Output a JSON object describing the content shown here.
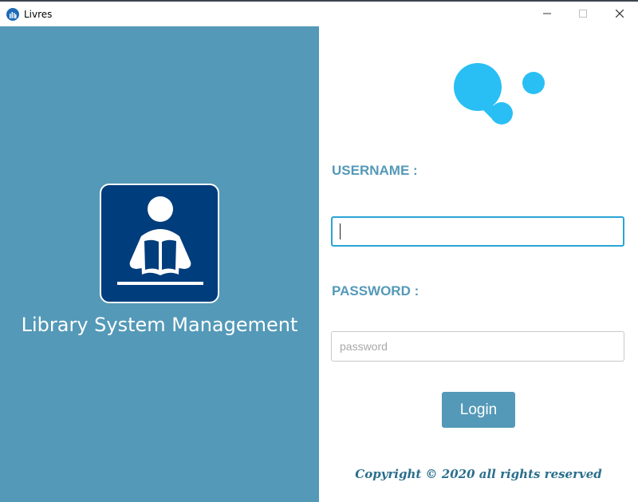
{
  "window": {
    "title": "Livres",
    "icon": "library-app-icon",
    "controls": {
      "minimize_icon": "minimize-icon",
      "maximize_icon": "maximize-icon",
      "close_icon": "close-icon"
    }
  },
  "left_panel": {
    "logo_icon": "reader-book-icon",
    "app_name": "Library System Management",
    "background_color": "#5499b8",
    "logo_color": "#003d7c"
  },
  "login_form": {
    "brand_icon": "bubble-logo-icon",
    "username_label": "USERNAME :",
    "username_value": "",
    "password_label": "PASSWORD :",
    "password_placeholder": "password",
    "login_button": "Login",
    "accent_color": "#5499b8",
    "focus_color": "#2aa4d6"
  },
  "footer": {
    "copyright": "Copyright © 2020 all rights reserved"
  }
}
